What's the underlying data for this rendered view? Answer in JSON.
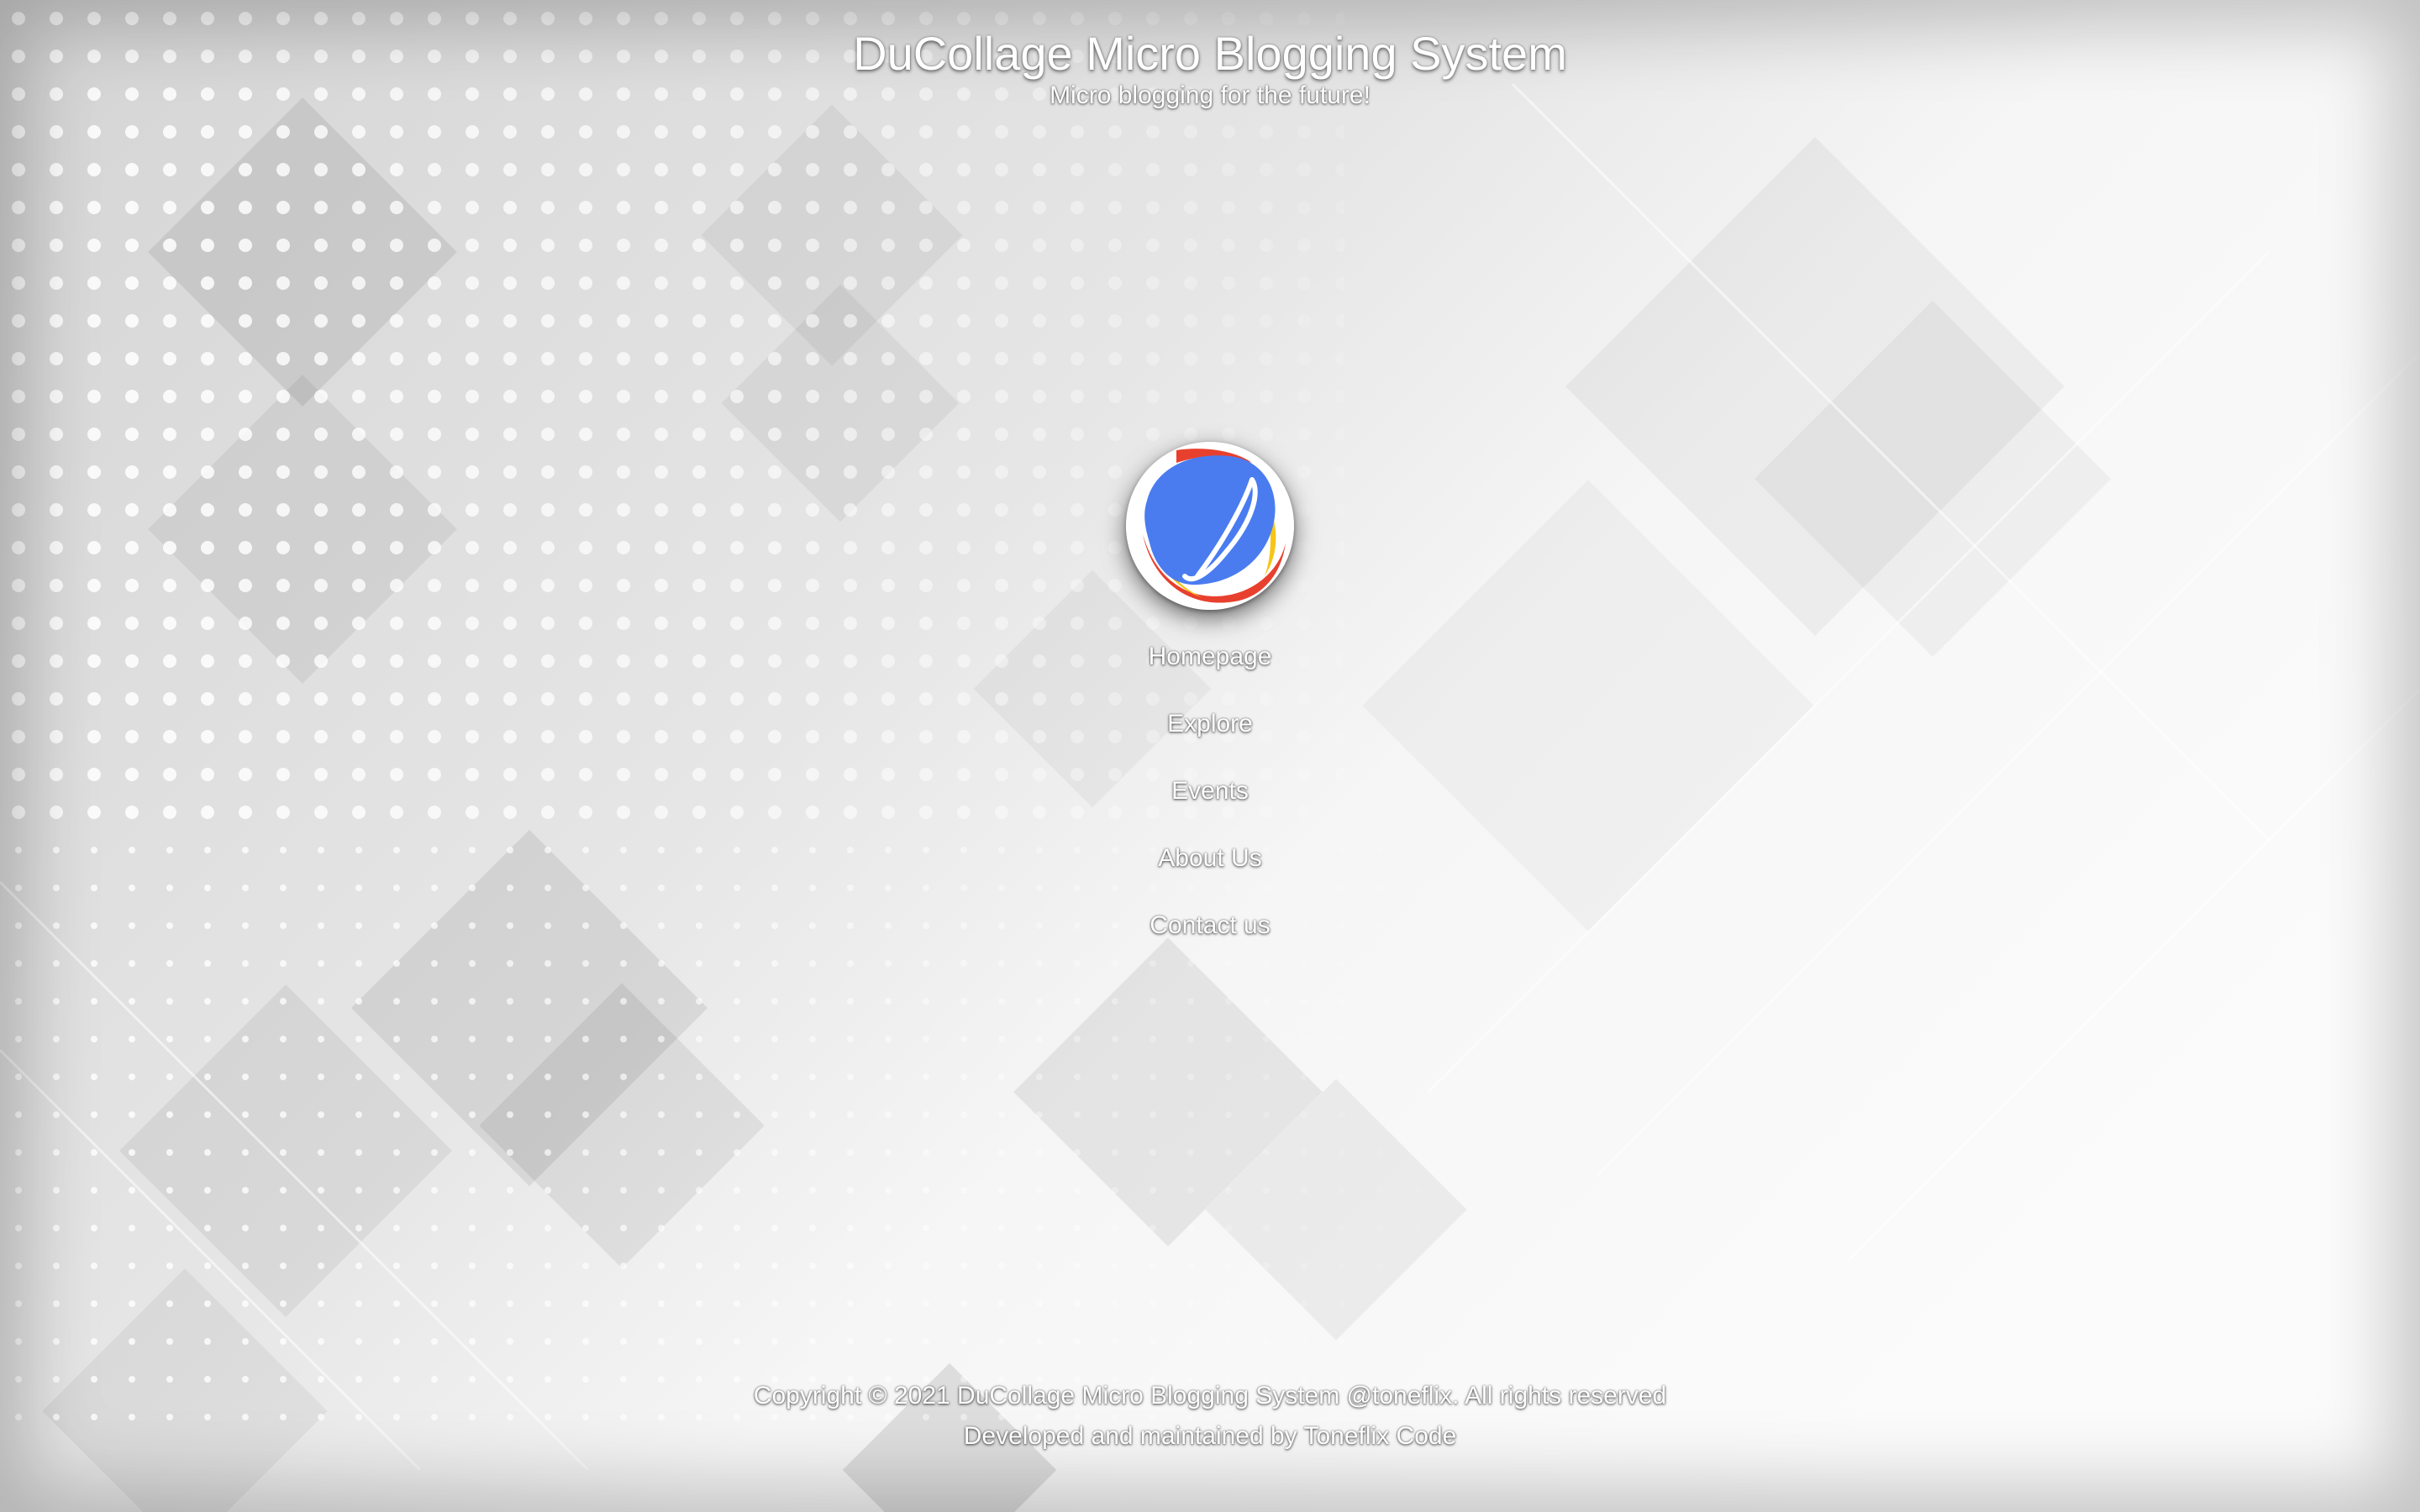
{
  "header": {
    "title": "DuCollage Micro Blogging System",
    "tagline": "Micro blogging for the future!"
  },
  "logo": {
    "icon": "ducollage-logo-icon",
    "colors": {
      "blue": "#4a7cf0",
      "red": "#e8402e",
      "yellow": "#f5c518",
      "white": "#ffffff"
    }
  },
  "nav": {
    "items": [
      {
        "label": "Homepage"
      },
      {
        "label": "Explore"
      },
      {
        "label": "Events"
      },
      {
        "label": "About Us"
      },
      {
        "label": "Contact us"
      }
    ]
  },
  "footer": {
    "copyright_prefix": "Copyright © 2021 ",
    "site_link": "DuCollage Micro Blogging System",
    "space": " ",
    "handle_link": "@toneflix",
    "rights": ". All rights reserved",
    "developed_by": "Developed and maintained by ",
    "developer_link": "Toneflix Code"
  },
  "theme": {
    "background": "#ececec",
    "text": "#ffffff"
  }
}
